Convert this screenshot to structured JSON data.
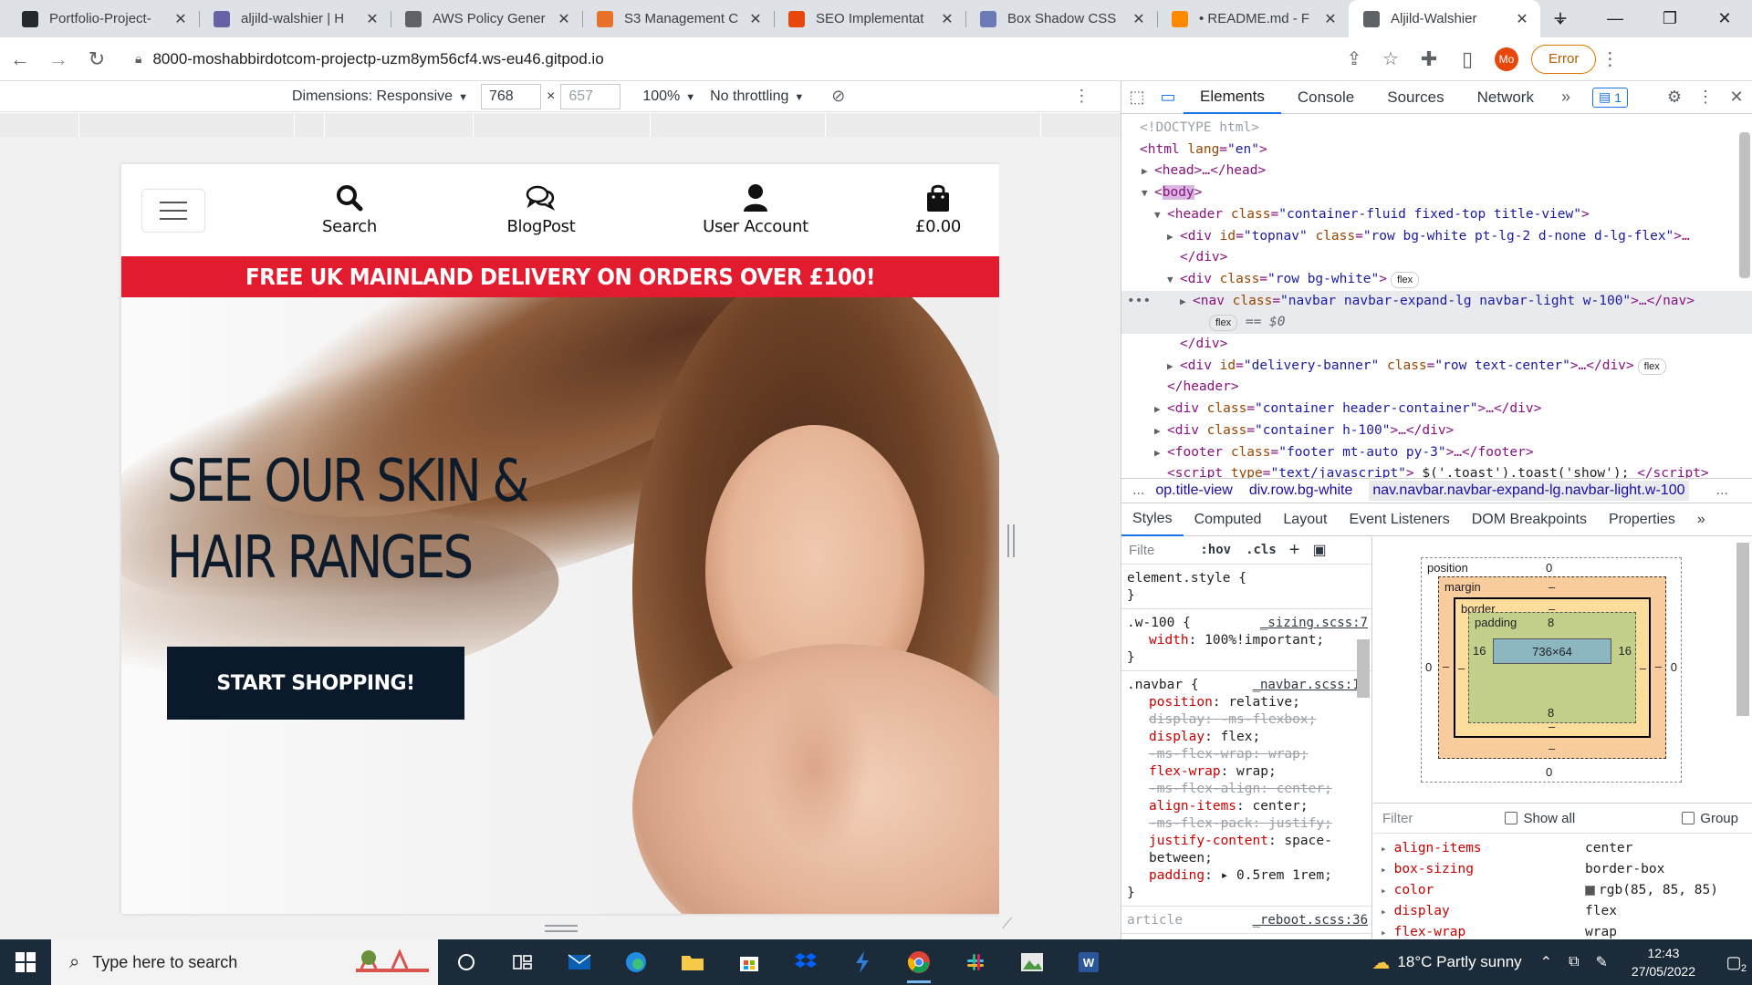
{
  "browser": {
    "tabs": [
      {
        "title": "Portfolio-Project-",
        "favicon": "github-icon",
        "color": "#24292e"
      },
      {
        "title": "aljild-walshier | H",
        "favicon": "heroku-icon",
        "color": "#6762a6"
      },
      {
        "title": "AWS Policy Gener",
        "favicon": "globe-icon",
        "color": "#5f6368"
      },
      {
        "title": "S3 Management C",
        "favicon": "aws-s3-icon",
        "color": "#e7732a"
      },
      {
        "title": "SEO Implementat",
        "favicon": "opera-icon",
        "color": "#e8470c"
      },
      {
        "title": "Box Shadow CSS",
        "favicon": "box-shadow-icon",
        "color": "#6c7bb5"
      },
      {
        "title": "• README.md - F",
        "favicon": "gitpod-icon",
        "color": "#ff8a00"
      },
      {
        "title": "Aljild-Walshier",
        "favicon": "globe-icon",
        "color": "#5f6368",
        "active": true
      }
    ],
    "url": "8000-moshabbirdotcom-projectp-uzm8ym56cf4.ws-eu46.gitpod.io",
    "profile_initials": "Mo",
    "error_label": "Error"
  },
  "device_toolbar": {
    "dimensions_label": "Dimensions: Responsive",
    "width": "768",
    "height": "657",
    "zoom": "100%",
    "throttling": "No throttling",
    "times": "×"
  },
  "site": {
    "nav": {
      "search": "Search",
      "blog": "BlogPost",
      "account": "User Account",
      "cart_total": "£0.00"
    },
    "banner": "FREE UK MAINLAND DELIVERY ON ORDERS OVER £100!",
    "hero": {
      "heading_line1": "SEE OUR SKIN &",
      "heading_line2": "HAIR RANGES",
      "cta": "START SHOPPING!"
    }
  },
  "devtools": {
    "tabs": [
      "Elements",
      "Console",
      "Sources",
      "Network"
    ],
    "issues_count": "1",
    "dom": {
      "doctype": "<!DOCTYPE html>",
      "html_open": "<html",
      "html_lang_attr": "lang",
      "html_lang_val": "\"en\"",
      "head": "<head>…</head>",
      "body": "body",
      "header_class": "\"container-fluid fixed-top title-view\"",
      "topnav_id": "\"topnav\"",
      "topnav_class": "\"row bg-white pt-lg-2 d-none d-lg-flex\"",
      "row_class": "\"row bg-white\"",
      "nav_class": "\"navbar navbar-expand-lg navbar-light w-100\"",
      "banner_id": "\"delivery-banner\"",
      "banner_class": "\"row text-center\"",
      "hc_class": "\"container header-container\"",
      "h100_class": "\"container h-100\"",
      "footer_class": "\"footer mt-auto py-3\"",
      "script_type": "\"text/javascript\"",
      "script_text": "$('.toast').toast('show');",
      "pill_flex": "flex",
      "dollar0": "== $0"
    },
    "breadcrumbs": [
      "...",
      "op.title-view",
      "div.row.bg-white",
      "nav.navbar.navbar-expand-lg.navbar-light.w-100",
      "..."
    ],
    "subtabs": [
      "Styles",
      "Computed",
      "Layout",
      "Event Listeners",
      "DOM Breakpoints",
      "Properties"
    ],
    "styles": {
      "filter_placeholder": "Filte",
      "hov": ":hov",
      "cls": ".cls",
      "element_style": "element.style {",
      "w100_selector": ".w-100 {",
      "w100_source": "_sizing.scss:7",
      "w100_props": [
        {
          "name": "width",
          "value": "100%!important;"
        }
      ],
      "navbar_selector": ".navbar {",
      "navbar_source": "_navbar.scss:19",
      "navbar_props": [
        {
          "name": "position",
          "value": "relative;",
          "struck": false
        },
        {
          "name": "display",
          "value": "-ms-flexbox;",
          "struck": true
        },
        {
          "name": "display",
          "value": "flex;",
          "struck": false
        },
        {
          "name": "-ms-flex-wrap",
          "value": "wrap;",
          "struck": true
        },
        {
          "name": "flex-wrap",
          "value": "wrap;",
          "struck": false
        },
        {
          "name": "-ms-flex-align",
          "value": "center;",
          "struck": true
        },
        {
          "name": "align-items",
          "value": "center;",
          "struck": false
        },
        {
          "name": "-ms-flex-pack",
          "value": "justify;",
          "struck": true
        },
        {
          "name": "justify-content",
          "value": "space-between;",
          "struck": false
        },
        {
          "name": "padding",
          "value": "▸ 0.5rem 1rem;",
          "struck": false
        }
      ],
      "close_brace": "}",
      "next_rule": "article",
      "next_source": "_reboot.scss:36"
    },
    "box_model": {
      "position_label": "position",
      "margin_label": "margin",
      "border_label": "border",
      "padding_label": "padding",
      "position_value": "0",
      "margin_value": "–",
      "border_value": "–",
      "padding_top": "8",
      "padding_bottom": "8",
      "padding_left": "16",
      "padding_right": "16",
      "content_size": "736×64",
      "outer_left": "0",
      "outer_right": "0",
      "outer_bottom": "0"
    },
    "computed": {
      "filter_placeholder": "Filter",
      "show_all": "Show all",
      "group": "Group",
      "rows": [
        {
          "name": "align-items",
          "value": "center"
        },
        {
          "name": "box-sizing",
          "value": "border-box"
        },
        {
          "name": "color",
          "value": "rgb(85, 85, 85)",
          "swatch": "#555555"
        },
        {
          "name": "display",
          "value": "flex"
        },
        {
          "name": "flex-wrap",
          "value": "wrap"
        }
      ]
    }
  },
  "taskbar": {
    "search_placeholder": "Type here to search",
    "weather": "18°C  Partly sunny",
    "time": "12:43",
    "date": "27/05/2022",
    "notification_count": "2"
  }
}
